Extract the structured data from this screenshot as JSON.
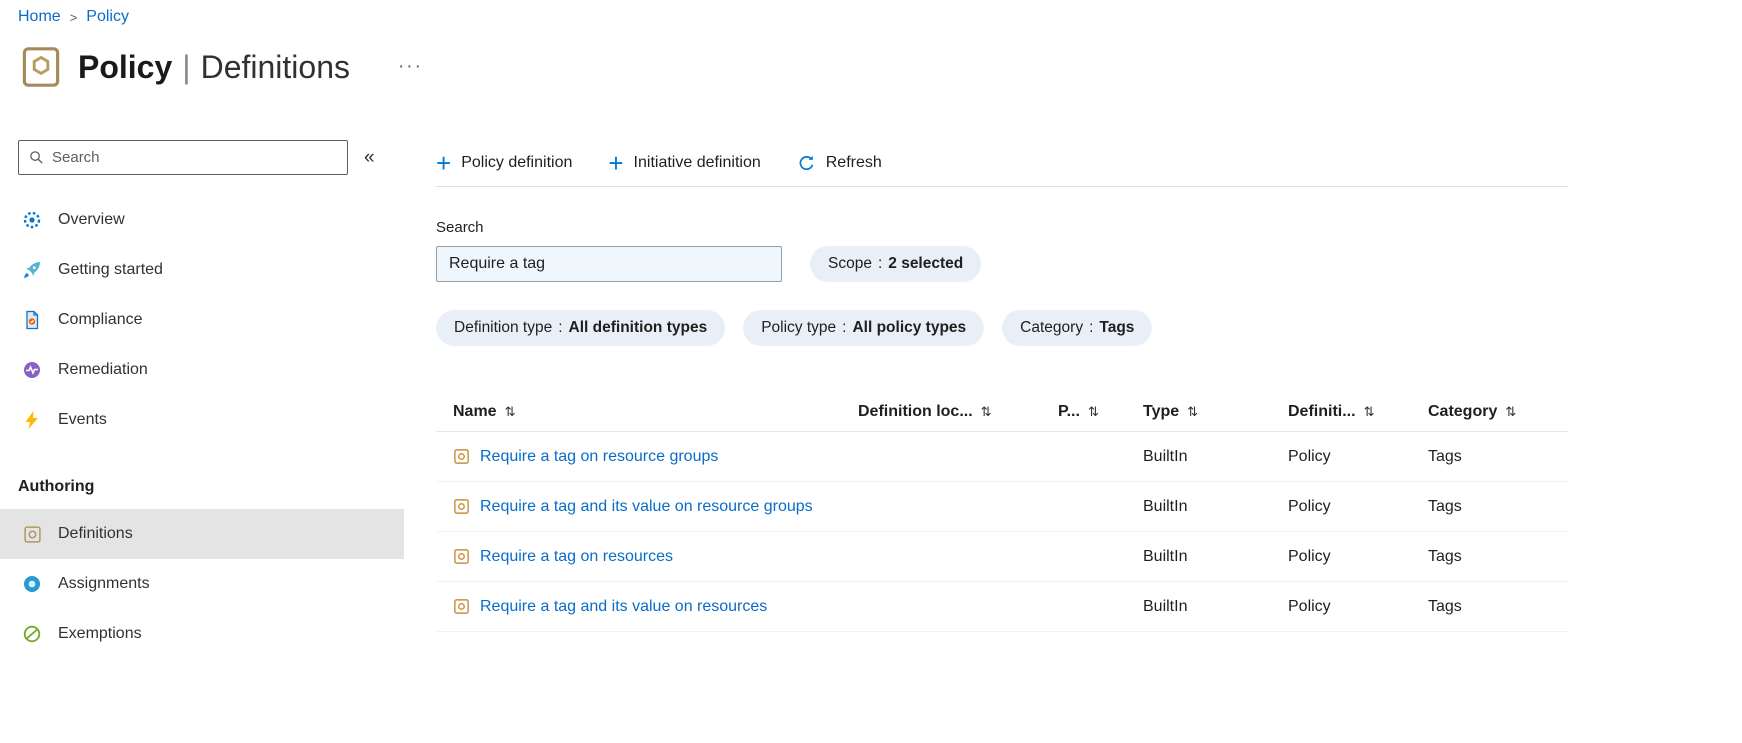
{
  "colors": {
    "accent": "#0078d4",
    "link": "#0b6cc8",
    "pill_background": "#e9eff7",
    "selected_item_background": "#e4e4e4",
    "search_filled_background": "#eff6fc",
    "divider": "#e1dfdd"
  },
  "icons": {
    "breadcrumb_separator": ">",
    "ellipsis": "···",
    "collapse": "«",
    "plus": "+",
    "sort": "⇅"
  },
  "breadcrumb": {
    "items": [
      {
        "label": "Home"
      },
      {
        "label": "Policy"
      }
    ]
  },
  "header": {
    "title_primary": "Policy",
    "title_divider": "|",
    "title_secondary": "Definitions"
  },
  "sidebar": {
    "search_placeholder": "Search",
    "items": [
      {
        "label": "Overview",
        "icon": "overview-icon"
      },
      {
        "label": "Getting started",
        "icon": "getting-started-icon"
      },
      {
        "label": "Compliance",
        "icon": "compliance-icon"
      },
      {
        "label": "Remediation",
        "icon": "remediation-icon"
      },
      {
        "label": "Events",
        "icon": "events-icon"
      }
    ],
    "section_label": "Authoring",
    "authoring_items": [
      {
        "label": "Definitions",
        "icon": "definitions-icon",
        "selected": true
      },
      {
        "label": "Assignments",
        "icon": "assignments-icon",
        "selected": false
      },
      {
        "label": "Exemptions",
        "icon": "exemptions-icon",
        "selected": false
      }
    ]
  },
  "toolbar": {
    "buttons": [
      {
        "label": "Policy definition",
        "icon": "plus-icon"
      },
      {
        "label": "Initiative definition",
        "icon": "plus-icon"
      },
      {
        "label": "Refresh",
        "icon": "refresh-icon"
      }
    ]
  },
  "filters": {
    "search_label": "Search",
    "search_value": "Require a tag",
    "pill_separator": ":",
    "pills": [
      {
        "label": "Scope",
        "value": "2 selected"
      },
      {
        "label": "Definition type",
        "value": "All definition types"
      },
      {
        "label": "Policy type",
        "value": "All policy types"
      },
      {
        "label": "Category",
        "value": "Tags"
      }
    ]
  },
  "table": {
    "sort_glyph": "⇅",
    "columns": [
      {
        "label": "Name"
      },
      {
        "label": "Definition loc..."
      },
      {
        "label": "P..."
      },
      {
        "label": "Type"
      },
      {
        "label": "Definiti..."
      },
      {
        "label": "Category"
      }
    ],
    "rows": [
      {
        "name": "Require a tag on resource groups",
        "definition_location": "",
        "p": "",
        "type": "BuiltIn",
        "definition": "Policy",
        "category": "Tags"
      },
      {
        "name": "Require a tag and its value on resource groups",
        "definition_location": "",
        "p": "",
        "type": "BuiltIn",
        "definition": "Policy",
        "category": "Tags"
      },
      {
        "name": "Require a tag on resources",
        "definition_location": "",
        "p": "",
        "type": "BuiltIn",
        "definition": "Policy",
        "category": "Tags"
      },
      {
        "name": "Require a tag and its value on resources",
        "definition_location": "",
        "p": "",
        "type": "BuiltIn",
        "definition": "Policy",
        "category": "Tags"
      }
    ]
  }
}
